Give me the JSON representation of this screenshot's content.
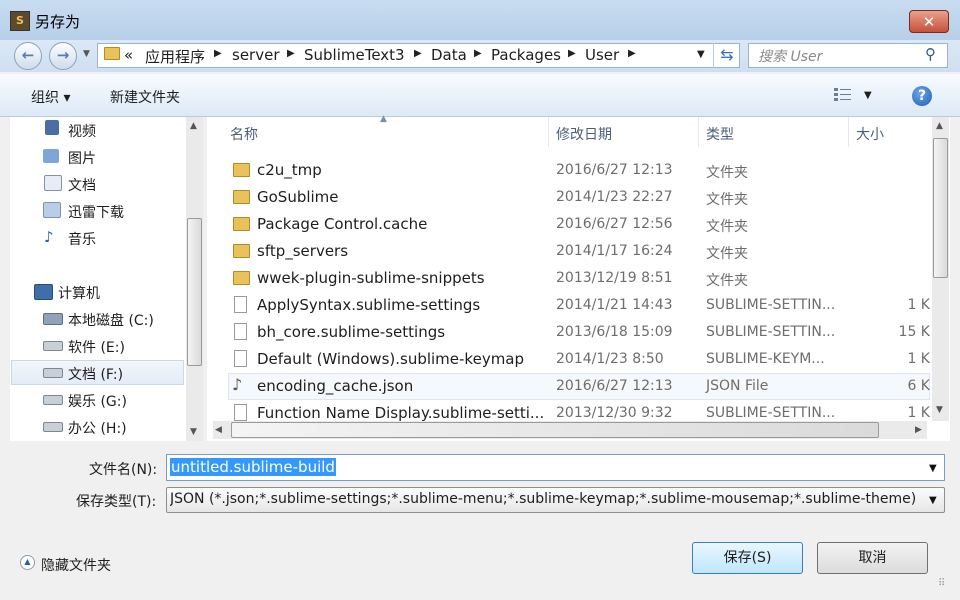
{
  "window": {
    "title": "另存为",
    "close_glyph": "✕"
  },
  "nav": {
    "back_glyph": "←",
    "forward_glyph": "→"
  },
  "breadcrumb": [
    "«",
    "应用程序",
    "server",
    "SublimeText3",
    "Data",
    "Packages",
    "User"
  ],
  "search": {
    "placeholder": "搜索 User"
  },
  "toolbar": {
    "organize": "组织 ▾",
    "new_folder": "新建文件夹",
    "help": "?"
  },
  "sidebar": {
    "items": [
      {
        "label": "视频",
        "icon": "video-library-icon"
      },
      {
        "label": "图片",
        "icon": "pictures-library-icon"
      },
      {
        "label": "文档",
        "icon": "documents-library-icon"
      },
      {
        "label": "迅雷下载",
        "icon": "downloads-library-icon"
      },
      {
        "label": "音乐",
        "icon": "music-library-icon"
      },
      {
        "label": "计算机",
        "icon": "computer-icon"
      },
      {
        "label": "本地磁盘 (C:)",
        "icon": "drive-icon"
      },
      {
        "label": "软件 (E:)",
        "icon": "drive-icon"
      },
      {
        "label": "文档 (F:)",
        "icon": "drive-icon",
        "selected": true
      },
      {
        "label": "娱乐 (G:)",
        "icon": "drive-icon"
      },
      {
        "label": "办公 (H:)",
        "icon": "drive-icon"
      }
    ]
  },
  "columns": {
    "name": "名称",
    "date": "修改日期",
    "type": "类型",
    "size": "大小"
  },
  "files": [
    {
      "name": "c2u_tmp",
      "date": "2016/6/27 12:13",
      "type": "文件夹",
      "size": "",
      "kind": "folder"
    },
    {
      "name": "GoSublime",
      "date": "2014/1/23 22:27",
      "type": "文件夹",
      "size": "",
      "kind": "folder"
    },
    {
      "name": "Package Control.cache",
      "date": "2016/6/27 12:56",
      "type": "文件夹",
      "size": "",
      "kind": "folder"
    },
    {
      "name": "sftp_servers",
      "date": "2014/1/17 16:24",
      "type": "文件夹",
      "size": "",
      "kind": "folder"
    },
    {
      "name": "wwek-plugin-sublime-snippets",
      "date": "2013/12/19 8:51",
      "type": "文件夹",
      "size": "",
      "kind": "folder"
    },
    {
      "name": "ApplySyntax.sublime-settings",
      "date": "2014/1/21 14:43",
      "type": "SUBLIME-SETTIN...",
      "size": "1 K",
      "kind": "file"
    },
    {
      "name": "bh_core.sublime-settings",
      "date": "2013/6/18 15:09",
      "type": "SUBLIME-SETTIN...",
      "size": "15 K",
      "kind": "file"
    },
    {
      "name": "Default (Windows).sublime-keymap",
      "date": "2014/1/23 8:50",
      "type": "SUBLIME-KEYM...",
      "size": "1 K",
      "kind": "file"
    },
    {
      "name": "encoding_cache.json",
      "date": "2016/6/27 12:13",
      "type": "JSON File",
      "size": "6 K",
      "kind": "json"
    },
    {
      "name": "Function Name Display.sublime-setti...",
      "date": "2013/12/30 9:32",
      "type": "SUBLIME-SETTIN...",
      "size": "1 K",
      "kind": "file"
    }
  ],
  "form": {
    "filename_label": "文件名(N):",
    "filename_value": "untitled.sublime-build",
    "filetype_label": "保存类型(T):",
    "filetype_value": "JSON (*.json;*.sublime-settings;*.sublime-menu;*.sublime-keymap;*.sublime-mousemap;*.sublime-theme)"
  },
  "footer": {
    "hide_folders": "隐藏文件夹",
    "save": "保存(S)",
    "cancel": "取消"
  }
}
